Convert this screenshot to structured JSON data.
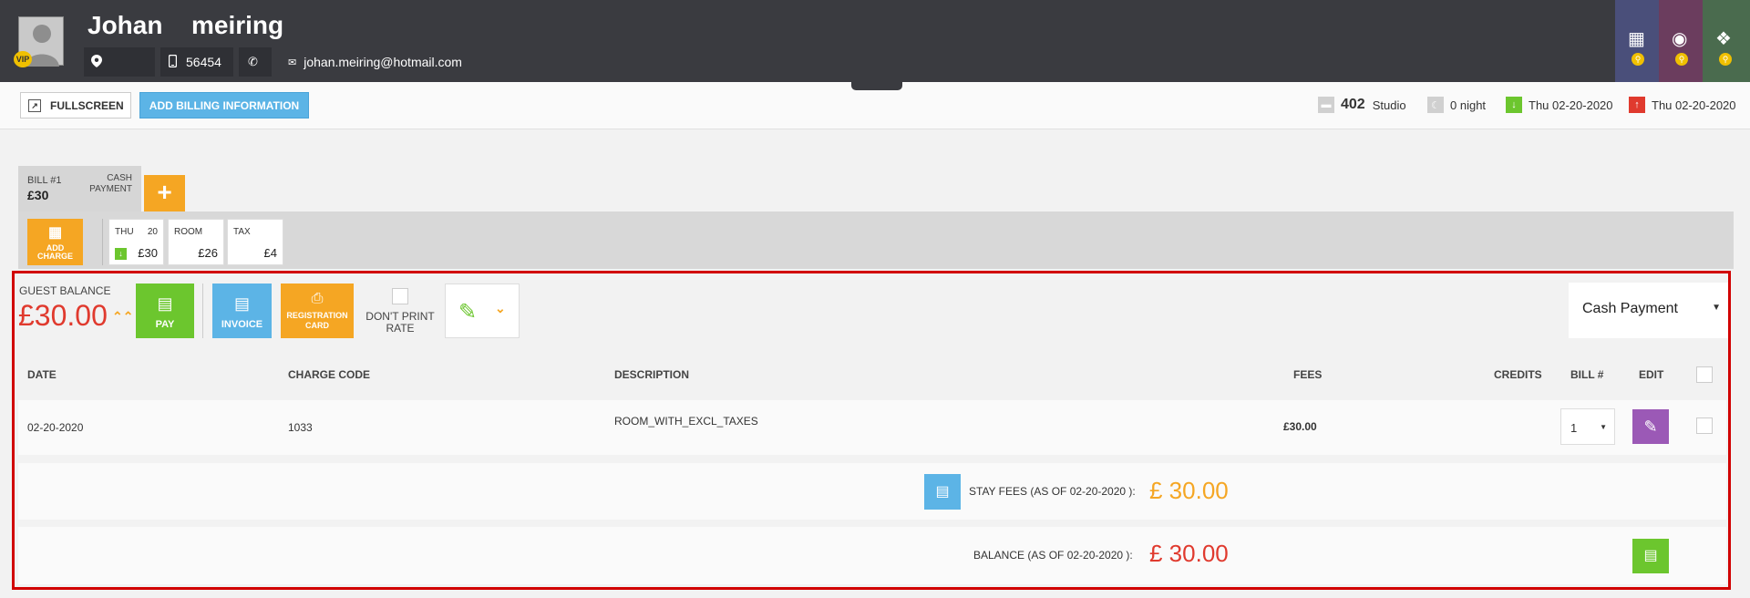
{
  "header": {
    "first_name": "Johan",
    "last_name": "meiring",
    "vip_badge": "VIP",
    "phone": "56454",
    "email": "johan.meiring@hotmail.com",
    "side_tabs": [
      {
        "icon": "building-icon",
        "color": "#4a4f7a"
      },
      {
        "icon": "globe-icon",
        "color": "#6b3d5e"
      },
      {
        "icon": "network-icon",
        "color": "#4a6b4e"
      }
    ]
  },
  "toolbar": {
    "fullscreen_label": "FULLSCREEN",
    "add_billing_label": "ADD BILLING INFORMATION"
  },
  "stay_summary": {
    "room_number": "402",
    "room_type": "Studio",
    "nights": "0 night",
    "arrival": "Thu 02-20-2020",
    "departure": "Thu 02-20-2020"
  },
  "bill_tab": {
    "title": "BILL #1",
    "amount": "£30",
    "method_line1": "CASH",
    "method_line2": "PAYMENT"
  },
  "charges_row": {
    "add_charge_line1": "ADD",
    "add_charge_line2": "CHARGE",
    "cards": [
      {
        "label": "THU",
        "extra": "20",
        "value": "£30"
      },
      {
        "label": "ROOM",
        "extra": "",
        "value": "£26"
      },
      {
        "label": "TAX",
        "extra": "",
        "value": "£4"
      }
    ]
  },
  "balance_panel": {
    "guest_balance_label": "GUEST BALANCE",
    "guest_balance_value": "£30.00",
    "pay_label": "PAY",
    "invoice_label": "INVOICE",
    "registration_line1": "REGISTRATION",
    "registration_line2": "CARD",
    "dont_print_line1": "DON'T PRINT",
    "dont_print_line2": "RATE",
    "payment_method": "Cash Payment"
  },
  "table": {
    "columns": [
      "DATE",
      "CHARGE CODE",
      "DESCRIPTION",
      "FEES",
      "CREDITS",
      "BILL #",
      "EDIT"
    ],
    "rows": [
      {
        "date": "02-20-2020",
        "charge_code": "1033",
        "description": "ROOM_WITH_EXCL_TAXES",
        "fees": "£30.00",
        "credits": "",
        "bill": "1"
      }
    ]
  },
  "totals": {
    "stay_fees_label": "STAY FEES (AS OF 02-20-2020 ):",
    "stay_fees_value": "£ 30.00",
    "balance_label": "BALANCE (AS OF 02-20-2020 ):",
    "balance_value": "£ 30.00"
  },
  "colors": {
    "header_bg": "#3a3b40",
    "orange": "#f5a623",
    "green": "#6cc62e",
    "blue": "#5cb4e6",
    "red": "#e03a2e",
    "purple": "#9b59b6"
  }
}
